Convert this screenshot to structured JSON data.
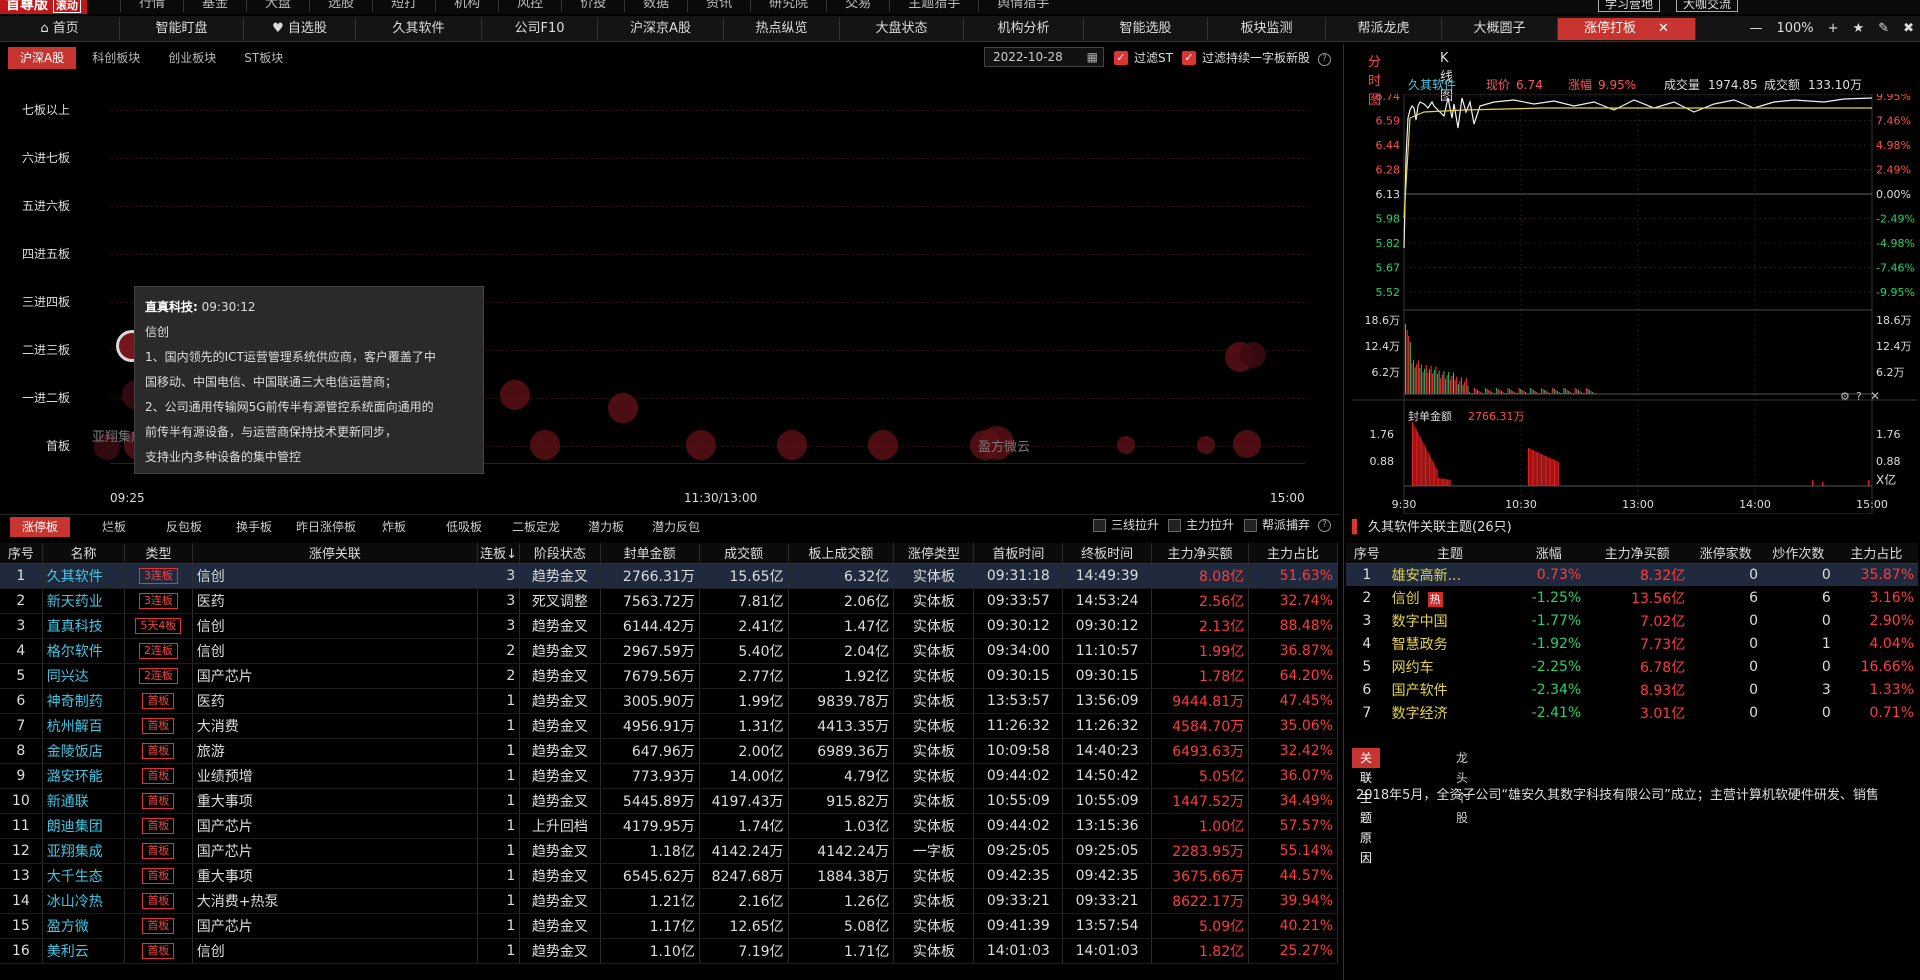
{
  "topbar": {
    "logo": "首尊版",
    "logo_sub": "滚动",
    "menu": [
      "行情",
      "基金",
      "大盘",
      "选股",
      "短打",
      "机构",
      "风控",
      "价投",
      "数据",
      "资讯",
      "研究院",
      "交易",
      "主题猎手",
      "舆情猎手"
    ],
    "btn_learn": "学习营地",
    "btn_exchange": "大咖交流"
  },
  "navbar": {
    "tabs": [
      "首页",
      "智能盯盘",
      "自选股",
      "久其软件",
      "公司F10",
      "沪深京A股",
      "热点纵览",
      "大盘状态",
      "机构分析",
      "智能选股",
      "板块监测",
      "帮派龙虎",
      "大概圆子",
      "涨停打板"
    ],
    "active": "涨停打板",
    "zoom": "100%"
  },
  "ladder": {
    "subtabs": [
      "沪深A股",
      "科创板块",
      "创业板块",
      "ST板块"
    ],
    "date": "2022-10-28",
    "filter_st": "过滤ST",
    "filter_one": "过滤持续一字板新股",
    "levels": [
      "七板以上",
      "六进七板",
      "五进六板",
      "四进五板",
      "三进四板",
      "二进三板",
      "一进二板",
      "首板"
    ],
    "x_labels": [
      "09:25",
      "11:30/13:00",
      "15:00"
    ],
    "bubble_labels": [
      "亚翔集成",
      "盈方微云"
    ],
    "tooltip": {
      "name": "直真科技:",
      "time": "09:30:12",
      "tag": "信创",
      "lines": [
        "1、国内领先的ICT运营管理系统供应商，客户覆盖了中",
        "国移动、中国电信、中国联通三大电信运营商；",
        "2、公司通用传输网5G前传半有源管控系统面向通用的",
        "前传半有源设备，与运营商保持技术更新同步，",
        "支持业内多种设备的集中管控"
      ]
    }
  },
  "table": {
    "tabs": [
      "涨停板",
      "烂板",
      "反包板",
      "换手板",
      "昨日涨停板",
      "炸板",
      "低吸板",
      "二板定龙",
      "潜力板",
      "潜力反包"
    ],
    "checks": [
      "三线拉升",
      "主力拉升",
      "帮派捕弃"
    ],
    "headers": [
      "序号",
      "名称",
      "类型",
      "涨停关联",
      "连板↓",
      "阶段状态",
      "封单金额",
      "成交额",
      "板上成交额",
      "涨停类型",
      "首板时间",
      "终板时间",
      "主力净买额",
      "主力占比"
    ],
    "rows": [
      [
        "1",
        "久其软件",
        "3连板",
        "信创",
        "3",
        "趋势金叉",
        "2766.31万",
        "15.65亿",
        "6.32亿",
        "实体板",
        "09:31:18",
        "14:49:39",
        "8.08亿",
        "51.63%"
      ],
      [
        "2",
        "新天药业",
        "3连板",
        "医药",
        "3",
        "死叉调整",
        "7563.72万",
        "7.81亿",
        "2.06亿",
        "实体板",
        "09:33:57",
        "14:53:24",
        "2.56亿",
        "32.74%"
      ],
      [
        "3",
        "直真科技",
        "5天4板",
        "信创",
        "3",
        "趋势金叉",
        "6144.42万",
        "2.41亿",
        "1.47亿",
        "实体板",
        "09:30:12",
        "09:30:12",
        "2.13亿",
        "88.48%"
      ],
      [
        "4",
        "格尔软件",
        "2连板",
        "信创",
        "2",
        "趋势金叉",
        "2967.59万",
        "5.40亿",
        "2.04亿",
        "实体板",
        "09:34:00",
        "11:10:57",
        "1.99亿",
        "36.87%"
      ],
      [
        "5",
        "同兴达",
        "2连板",
        "国产芯片",
        "2",
        "趋势金叉",
        "7679.56万",
        "2.77亿",
        "1.92亿",
        "实体板",
        "09:30:15",
        "09:30:15",
        "1.78亿",
        "64.20%"
      ],
      [
        "6",
        "神奇制药",
        "首板",
        "医药",
        "1",
        "趋势金叉",
        "3005.90万",
        "1.99亿",
        "9839.78万",
        "实体板",
        "13:53:57",
        "13:56:09",
        "9444.81万",
        "47.45%"
      ],
      [
        "7",
        "杭州解百",
        "首板",
        "大消费",
        "1",
        "趋势金叉",
        "4956.91万",
        "1.31亿",
        "4413.35万",
        "实体板",
        "11:26:32",
        "11:26:32",
        "4584.70万",
        "35.06%"
      ],
      [
        "8",
        "金陵饭店",
        "首板",
        "旅游",
        "1",
        "趋势金叉",
        "647.96万",
        "2.00亿",
        "6989.36万",
        "实体板",
        "10:09:58",
        "14:40:23",
        "6493.63万",
        "32.42%"
      ],
      [
        "9",
        "潞安环能",
        "首板",
        "业绩预增",
        "1",
        "趋势金叉",
        "773.93万",
        "14.00亿",
        "4.79亿",
        "实体板",
        "09:44:02",
        "14:50:42",
        "5.05亿",
        "36.07%"
      ],
      [
        "10",
        "新通联",
        "首板",
        "重大事项",
        "1",
        "趋势金叉",
        "5445.89万",
        "4197.43万",
        "915.82万",
        "实体板",
        "10:55:09",
        "10:55:09",
        "1447.52万",
        "34.49%"
      ],
      [
        "11",
        "朗迪集团",
        "首板",
        "国产芯片",
        "1",
        "上升回档",
        "4179.95万",
        "1.74亿",
        "1.03亿",
        "实体板",
        "09:44:02",
        "13:15:36",
        "1.00亿",
        "57.57%"
      ],
      [
        "12",
        "亚翔集成",
        "首板",
        "国产芯片",
        "1",
        "趋势金叉",
        "1.18亿",
        "4142.24万",
        "4142.24万",
        "一字板",
        "09:25:05",
        "09:25:05",
        "2283.95万",
        "55.14%"
      ],
      [
        "13",
        "大千生态",
        "首板",
        "重大事项",
        "1",
        "趋势金叉",
        "6545.62万",
        "8247.68万",
        "1884.38万",
        "实体板",
        "09:42:35",
        "09:42:35",
        "3675.66万",
        "44.57%"
      ],
      [
        "14",
        "冰山冷热",
        "首板",
        "大消费+热泵",
        "1",
        "趋势金叉",
        "1.21亿",
        "2.16亿",
        "1.26亿",
        "实体板",
        "09:33:21",
        "09:33:21",
        "8622.17万",
        "39.94%"
      ],
      [
        "15",
        "盈方微",
        "首板",
        "国产芯片",
        "1",
        "趋势金叉",
        "1.17亿",
        "12.65亿",
        "5.08亿",
        "实体板",
        "09:41:39",
        "13:57:54",
        "5.09亿",
        "40.21%"
      ],
      [
        "16",
        "美利云",
        "首板",
        "信创",
        "1",
        "趋势金叉",
        "1.10亿",
        "7.19亿",
        "1.71亿",
        "实体板",
        "14:01:03",
        "14:01:03",
        "1.82亿",
        "25.27%"
      ]
    ]
  },
  "right": {
    "tabs": [
      "分时图",
      "K线图"
    ],
    "quote": {
      "name": "久其软件",
      "price_label": "现价",
      "price": "6.74",
      "chg_label": "涨幅",
      "chg": "9.95%",
      "vol_label": "成交量",
      "vol": "1974.85",
      "amt_label": "成交额",
      "amt": "133.10万"
    },
    "y_left": [
      "6.74",
      "6.59",
      "6.44",
      "6.28",
      "6.13",
      "5.98",
      "5.82",
      "5.67",
      "5.52"
    ],
    "y_right": [
      "9.95%",
      "7.46%",
      "4.98%",
      "2.49%",
      "0.00%",
      "-2.49%",
      "-4.98%",
      "-7.46%",
      "-9.95%"
    ],
    "vol_left": [
      "18.6万",
      "12.4万",
      "6.2万"
    ],
    "vol_right": [
      "18.6万",
      "12.4万",
      "6.2万"
    ],
    "seal_label": "封单金额",
    "seal_value": "2766.31万",
    "seal_left": [
      "1.76",
      "0.88"
    ],
    "seal_right": [
      "1.76",
      "0.88"
    ],
    "seal_unit": "X亿",
    "x_labels": [
      "9:30",
      "10:30",
      "13:00",
      "14:00",
      "15:00"
    ],
    "theme_title": "久其软件关联主题(26只)",
    "theme_headers": [
      "序号",
      "主题",
      "涨幅",
      "主力净买额",
      "涨停家数",
      "炒作次数",
      "主力占比"
    ],
    "themes": [
      [
        "1",
        "雄安高新...",
        "0.73%",
        "8.32亿",
        "0",
        "0",
        "35.87%",
        ""
      ],
      [
        "2",
        "信创",
        "-1.25%",
        "13.56亿",
        "6",
        "6",
        "3.16%",
        "热"
      ],
      [
        "3",
        "数字中国",
        "-1.77%",
        "7.02亿",
        "0",
        "0",
        "2.90%",
        ""
      ],
      [
        "4",
        "智慧政务",
        "-1.92%",
        "7.73亿",
        "0",
        "1",
        "4.04%",
        ""
      ],
      [
        "5",
        "网约车",
        "-2.25%",
        "6.78亿",
        "0",
        "0",
        "16.66%",
        ""
      ],
      [
        "6",
        "国产软件",
        "-2.34%",
        "8.93亿",
        "0",
        "3",
        "1.33%",
        ""
      ],
      [
        "7",
        "数字经济",
        "-2.41%",
        "3.01亿",
        "0",
        "0",
        "0.71%",
        ""
      ]
    ],
    "reason_tabs": [
      "关联主题原因",
      "龙头个股"
    ],
    "reason": "2018年5月，全资子公司“雄安久其数字科技有限公司”成立；主营计算机软硬件研发、销售"
  },
  "colors": {
    "accent": "#c8342f",
    "up": "#ff3b3b",
    "down": "#22d36a",
    "name": "#3fc7e6"
  }
}
